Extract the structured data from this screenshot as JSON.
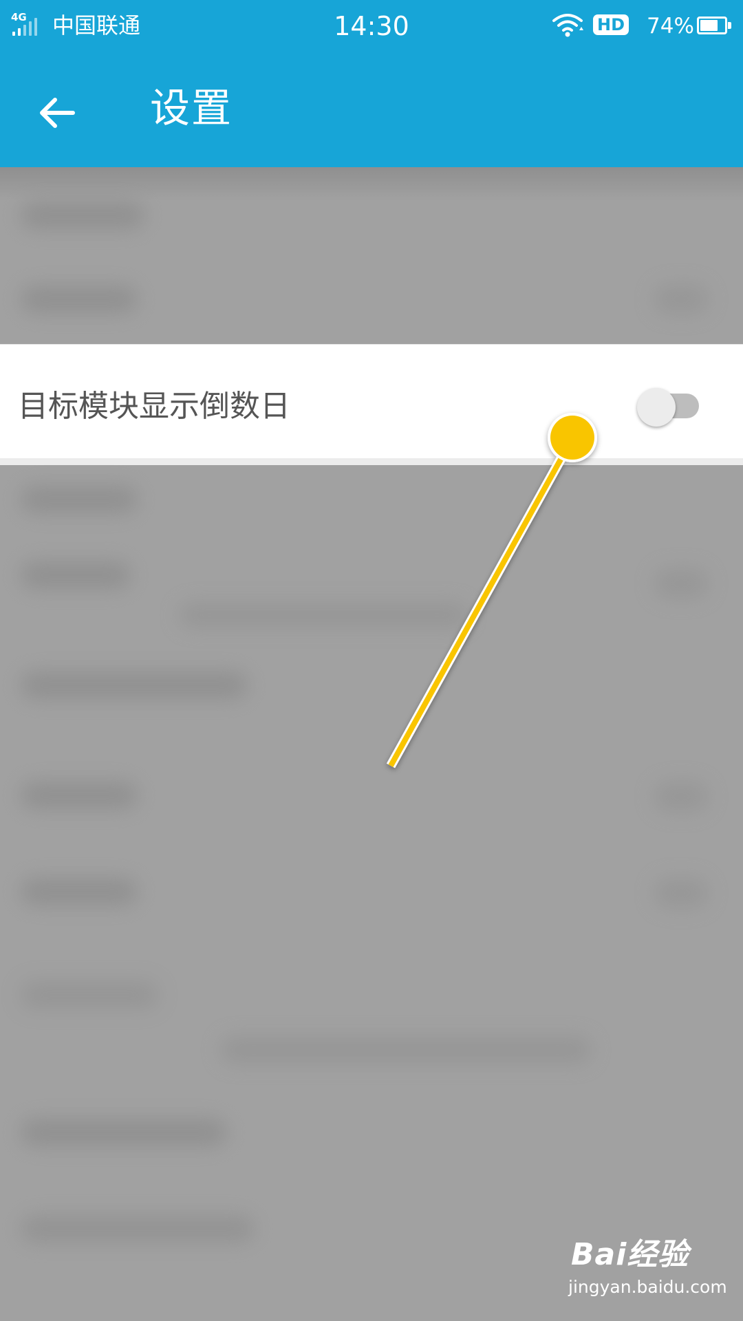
{
  "status_bar": {
    "network": "4G",
    "carrier": "中国联通",
    "time": "14:30",
    "hd_label": "HD",
    "battery_percent": "74%",
    "battery_level": 0.74
  },
  "app_bar": {
    "back_icon": "arrow-left-icon",
    "title": "设置"
  },
  "setting": {
    "label": "目标模块显示倒数日",
    "toggle_on": false
  },
  "annotation": {
    "color": "#f9c500"
  },
  "watermark": {
    "logo": "Bai经验",
    "url": "jingyan.baidu.com"
  }
}
